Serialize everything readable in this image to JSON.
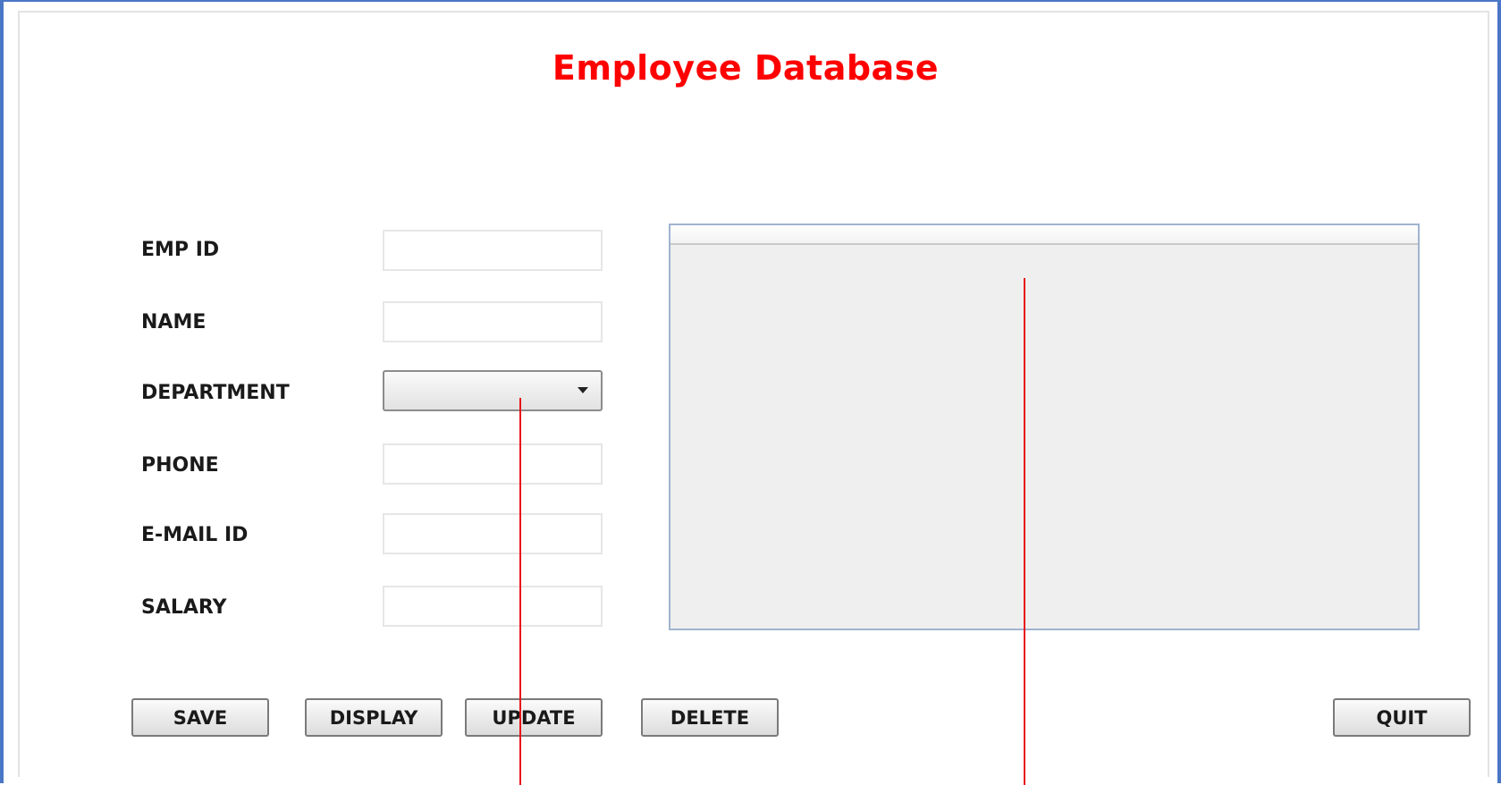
{
  "title": "Employee Database",
  "form": {
    "fields": [
      {
        "label": "EMP ID",
        "value": ""
      },
      {
        "label": "NAME",
        "value": ""
      },
      {
        "label": "DEPARTMENT",
        "selected": ""
      },
      {
        "label": "PHONE",
        "value": ""
      },
      {
        "label": "E-MAIL ID",
        "value": ""
      },
      {
        "label": "SALARY",
        "value": ""
      }
    ]
  },
  "buttons": {
    "save": "SAVE",
    "display": "DISPLAY",
    "update": "UPDATE",
    "delete": "DELETE",
    "quit": "QUIT"
  },
  "table": {
    "columns": [],
    "rows": []
  },
  "colors": {
    "title": "#ff0000",
    "window_border": "#4a76c6",
    "annotation_line": "#e8141b",
    "table_background": "#efefef"
  },
  "icons": {
    "dropdown": "chevron-down-icon"
  }
}
